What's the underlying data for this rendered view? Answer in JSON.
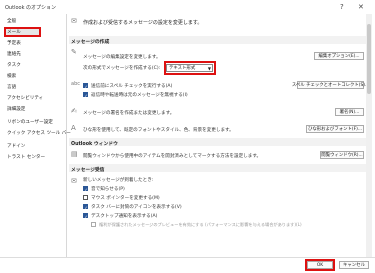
{
  "window": {
    "title": "Outlook のオプション",
    "help": "?",
    "close": "✕"
  },
  "sidebar": {
    "items": [
      "全般",
      "メール",
      "予定表",
      "連絡先",
      "タスク",
      "検索",
      "言語",
      "アクセシビリティ",
      "詳細設定",
      "リボンのユーザー設定",
      "クイック アクセス ツール バー",
      "アドイン",
      "トラスト センター"
    ],
    "selected": 1
  },
  "header": {
    "text": "作成および受信するメッセージの設定を変更します。"
  },
  "compose": {
    "section": "メッセージの作成",
    "edit_desc": "メッセージの編集設定を変更します。",
    "editor_button": "編集オプション(E)...",
    "format_label": "次の形式でメッセージを作成する(C):",
    "format_value": "テキスト形式",
    "spell_always": "送信前にスペル チェックを実行する(A)",
    "spell_ignore": "返信時や転送時は元のメッセージを無視する(I)",
    "spell_button": "スペル チェックとオートコレクト(S)...",
    "sig_desc": "メッセージの署名を作成または変更します。",
    "sig_button": "署名(N)...",
    "stationery_desc": "ひな形を使用して、既定のフォントやスタイル、色、背景を変更します。",
    "stationery_button": "ひな形およびフォント(F)..."
  },
  "pane": {
    "section": "Outlook ウィンドウ",
    "desc": "閲覧ウィンドウから使用中のアイテムを開封済みとしてマークする方法を設定します。",
    "button": "閲覧ウィンドウ(R)..."
  },
  "arrival": {
    "section": "メッセージ受信",
    "desc": "新しいメッセージが到着したとき:",
    "opt1": "音で知らせる(P)",
    "opt2": "マウス ポインターを変更する(M)",
    "opt3": "タスク バーに封筒のアイコンを表示する(V)",
    "opt4": "デスクトップ通知を表示する(A)",
    "opt5": "権利が保護されたメッセージのプレビューを有効にする (パフォーマンスに影響を与える場合があります)(L)"
  },
  "footer": {
    "ok": "OK",
    "cancel": "キャンセル"
  }
}
